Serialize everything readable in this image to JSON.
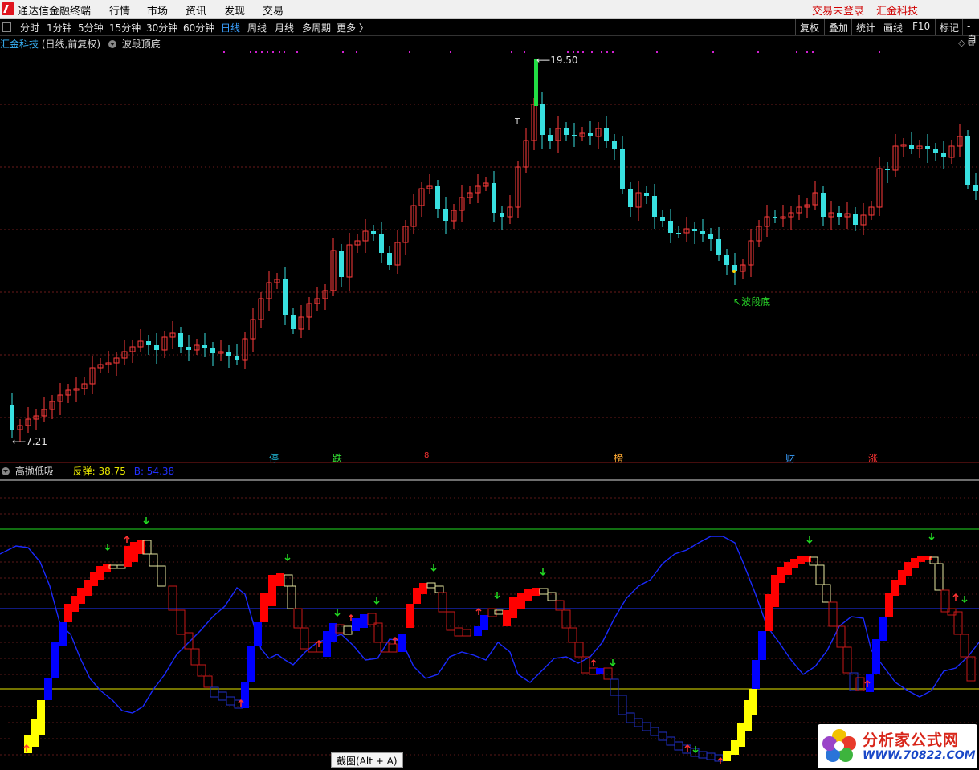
{
  "app": {
    "title": "通达信金融终端",
    "menu": [
      "行情",
      "市场",
      "资讯",
      "发现",
      "交易"
    ],
    "status_login": "交易未登录",
    "status_stock": "汇金科技"
  },
  "toolbar": {
    "periods": [
      "分时",
      "1分钟",
      "5分钟",
      "15分钟",
      "30分钟",
      "60分钟",
      "日线",
      "周线",
      "月线",
      "多周期",
      "更多 〉"
    ],
    "active_period": "日线",
    "right_buttons": [
      "复权",
      "叠加",
      "统计",
      "画线",
      "F10",
      "标记",
      "-自"
    ]
  },
  "main_chart": {
    "stock_name": "汇金科技",
    "mode": "(日线,前复权)",
    "indicator": "波段顶底",
    "high_label": "19.50",
    "low_label": "7.21",
    "bottom_label": "波段底",
    "t_marker": "T",
    "events": [
      "停",
      "跌",
      "8",
      "榜",
      "财",
      "涨"
    ]
  },
  "indicator_panel": {
    "name": "高抛低吸",
    "rebound_label": "反弹: 38.75",
    "b_label": "B: 54.38"
  },
  "tooltip": "截图(Alt + A)",
  "watermark": {
    "text_cn": "分析家公式网",
    "text_url": "WWW.70822.COM"
  },
  "colors": {
    "up": "#ff3b3b",
    "down": "#38e0e0",
    "accent_blue": "#3aa0ff",
    "line_blue": "#1a2aff",
    "yellow": "#ffff33",
    "green": "#22dd22"
  }
}
